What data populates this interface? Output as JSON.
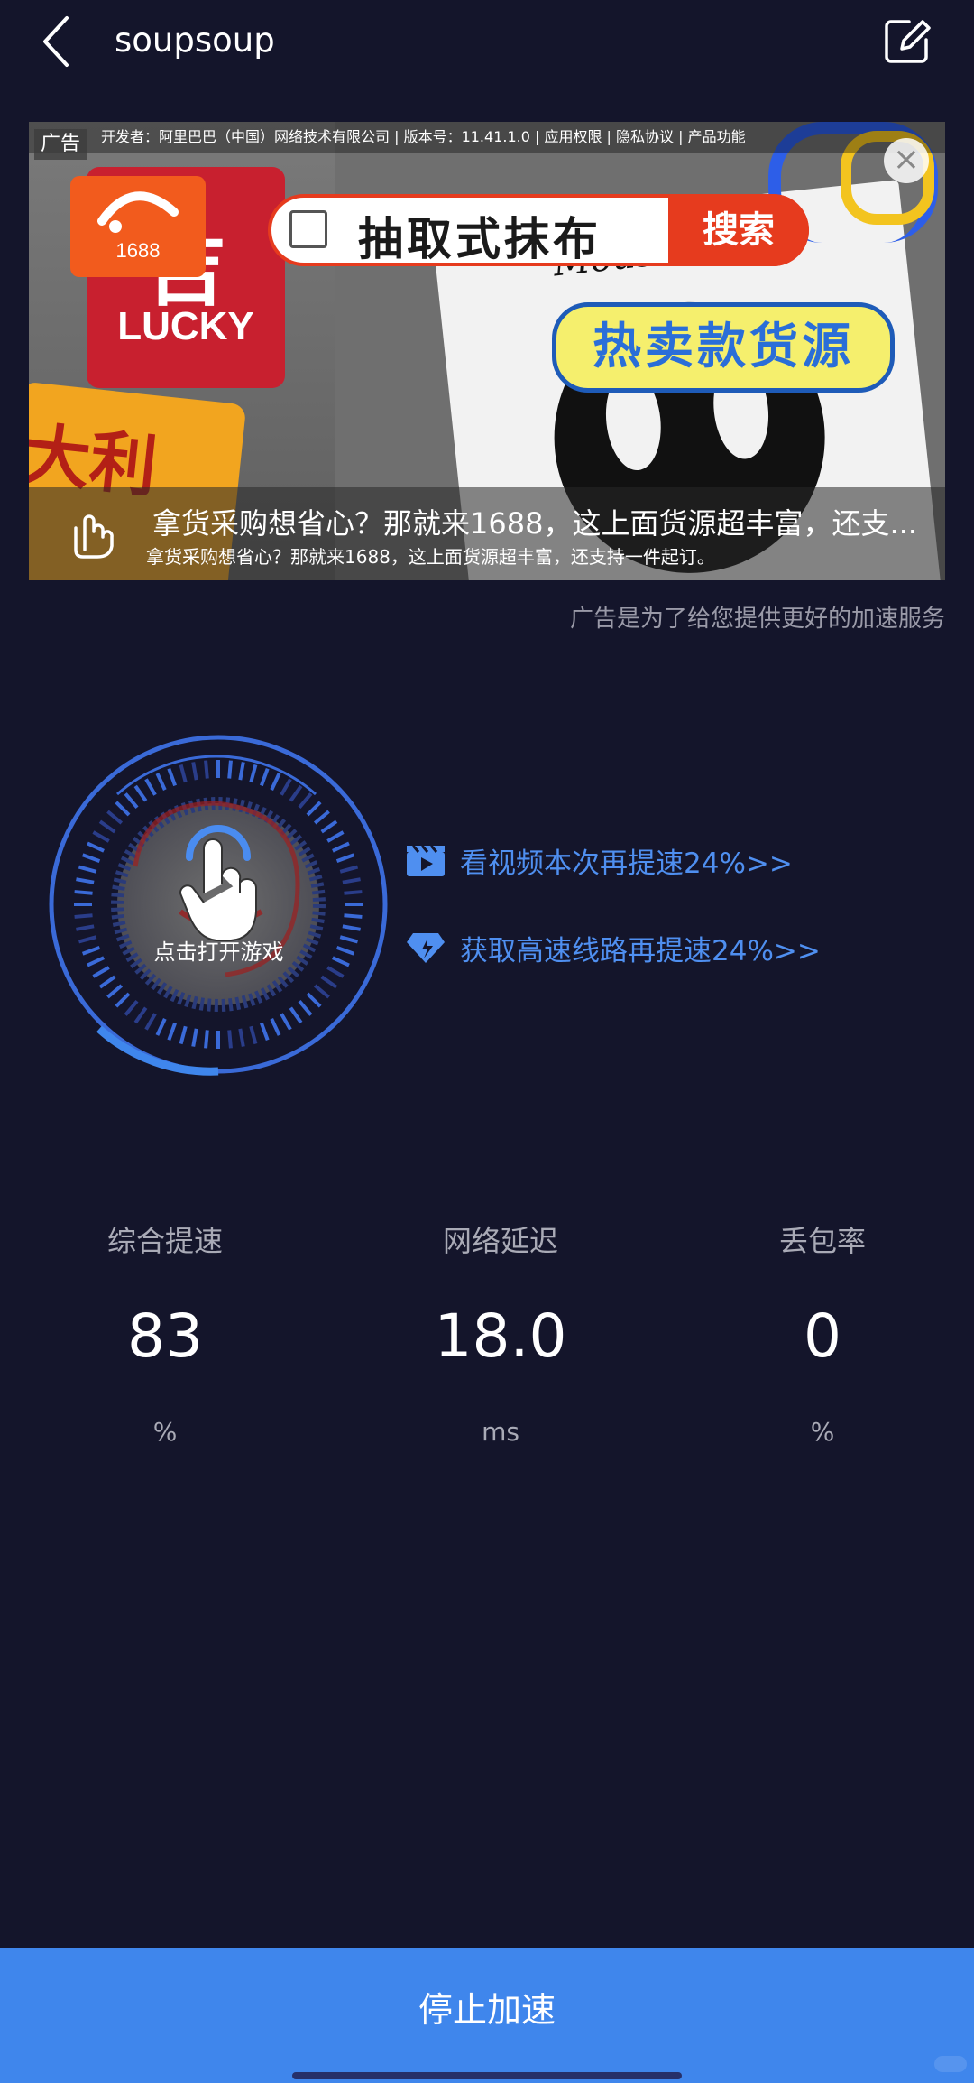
{
  "header": {
    "title": "soupsoup"
  },
  "ad": {
    "badge": "广告",
    "top_line": "开发者：阿里巴巴（中国）网络技术有限公司 | 版本号：11.41.1.0 | 应用权限 | 隐私协议 | 产品功能",
    "logo_text": "1688",
    "lucky_char": "吉",
    "lucky_text": "LUCKY",
    "orange_sign_text": "大利",
    "mickey_text": "Mouse",
    "search_text": "抽取式抹布",
    "search_button": "搜索",
    "hot_label": "热卖款货源",
    "caption_line1": "拿货采购想省心？那就来1688，这上面货源超丰富，还支...",
    "caption_line2": "拿货采购想省心？那就来1688，这上面货源超丰富，还支持一件起订。",
    "close_symbol": "×",
    "note": "广告是为了给您提供更好的加速服务"
  },
  "gauge": {
    "label": "点击打开游戏"
  },
  "promos": {
    "video_label": "看视频本次再提速24%>>",
    "route_label": "获取高速线路再提速24%>>"
  },
  "stats": [
    {
      "label": "综合提速",
      "value": "83",
      "unit": "%"
    },
    {
      "label": "网络延迟",
      "value": "18.0",
      "unit": "ms"
    },
    {
      "label": "丢包率",
      "value": "0",
      "unit": "%"
    }
  ],
  "footer": {
    "stop_label": "停止加速"
  },
  "colors": {
    "background": "#14152b",
    "accent_blue": "#4f8ff0",
    "button_blue": "#3f86ec"
  },
  "icons": {
    "back": "chevron-left-icon",
    "edit": "edit-square-icon",
    "video": "video-clapper-icon",
    "diamond": "diamond-icon",
    "tap": "hand-tap-icon"
  }
}
